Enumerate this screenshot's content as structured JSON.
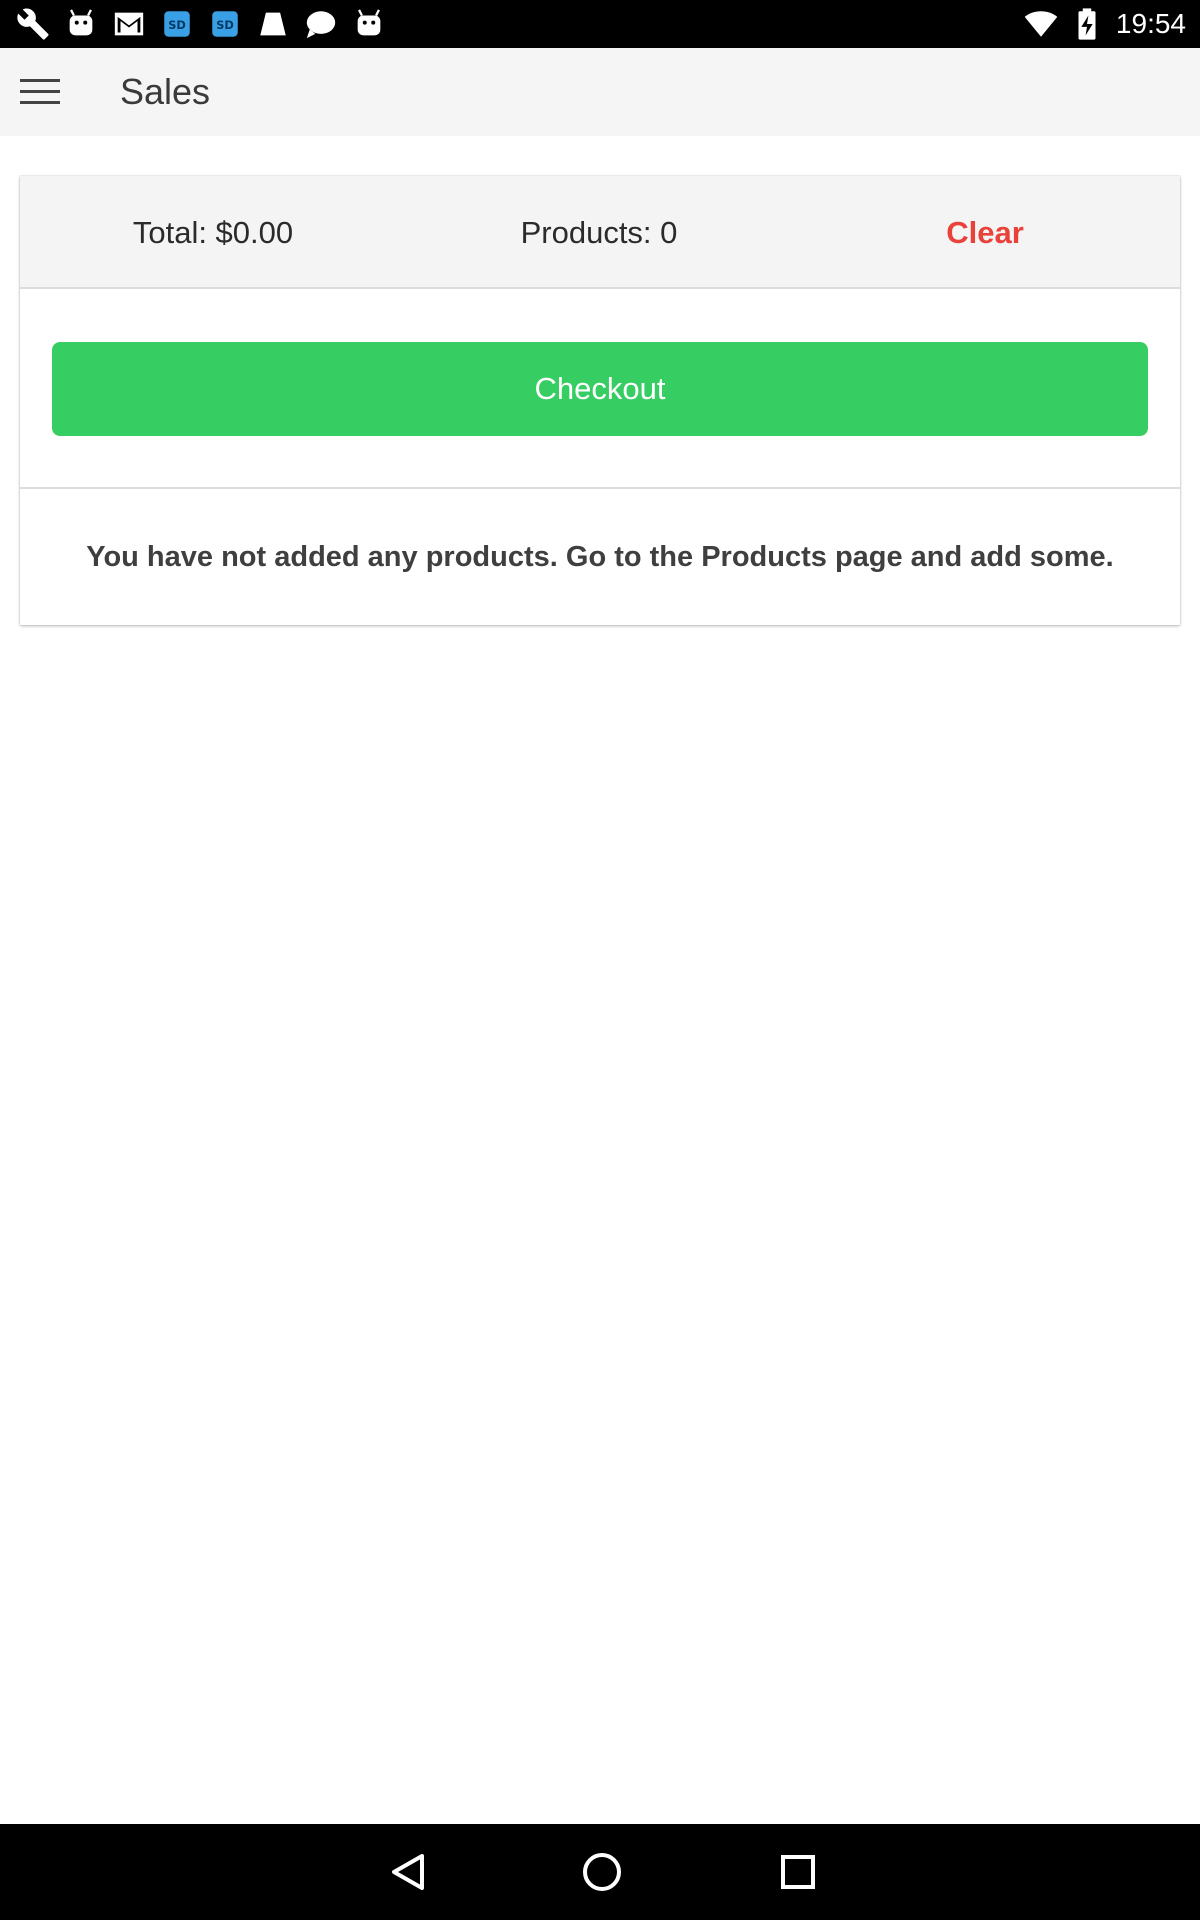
{
  "status_bar": {
    "time": "19:54",
    "left_icons": [
      "wrench-icon",
      "android-icon",
      "gmail-icon",
      "sd-card-icon",
      "sd-card-icon",
      "bucket-icon",
      "chat-bubble-icon",
      "android-icon"
    ],
    "right_icons": [
      "wifi-icon",
      "battery-charging-icon"
    ]
  },
  "app_bar": {
    "menu_icon": "hamburger-menu-icon",
    "title": "Sales"
  },
  "summary": {
    "total_label": "Total: $0.00",
    "products_label": "Products: 0",
    "clear_label": "Clear"
  },
  "checkout": {
    "label": "Checkout"
  },
  "empty_state": {
    "message": "You have not added any products. Go to the Products page and add some."
  },
  "nav_bar": {
    "icons": [
      "back-icon",
      "home-icon",
      "recent-apps-icon"
    ]
  },
  "colors": {
    "checkout_green": "#36cd63",
    "clear_red": "#e8423a",
    "app_bar_bg": "#f5f5f5"
  }
}
